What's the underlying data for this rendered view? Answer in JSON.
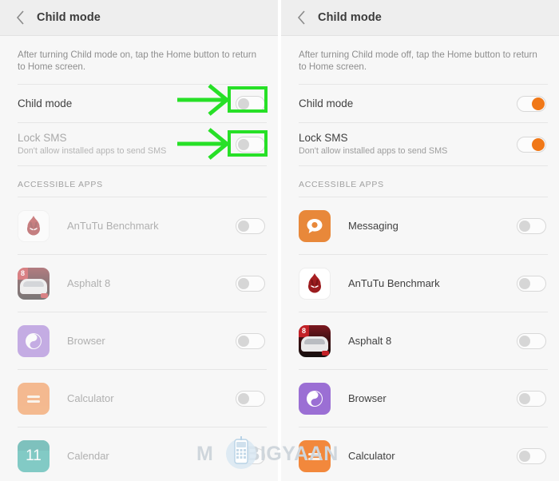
{
  "meta": {
    "watermark_text_left": "M",
    "watermark_text_right": "BIGYAAN",
    "accent_green": "#27e027",
    "accent_orange": "#f07818"
  },
  "panels": [
    {
      "id": "left",
      "appbar": {
        "title": "Child mode",
        "back_icon": "chevron-left-icon"
      },
      "description": "After turning Child mode on, tap the Home button to return to Home screen.",
      "settings": [
        {
          "title": "Child mode",
          "subtitle": "",
          "enabled": true,
          "toggle_on": false,
          "annotated": true
        },
        {
          "title": "Lock SMS",
          "subtitle": "Don't allow installed apps to send SMS",
          "enabled": false,
          "toggle_on": false,
          "annotated": true
        }
      ],
      "section_label": "ACCESSIBLE APPS",
      "apps": [
        {
          "name": "AnTuTu Benchmark",
          "icon": "antutu-icon",
          "toggle_on": false,
          "enabled": false
        },
        {
          "name": "Asphalt 8",
          "icon": "asphalt8-icon",
          "toggle_on": false,
          "enabled": false
        },
        {
          "name": "Browser",
          "icon": "browser-icon",
          "toggle_on": false,
          "enabled": false
        },
        {
          "name": "Calculator",
          "icon": "calculator-icon",
          "toggle_on": false,
          "enabled": false
        },
        {
          "name": "Calendar",
          "icon": "calendar-icon",
          "badge": "11",
          "toggle_on": false,
          "enabled": false
        }
      ]
    },
    {
      "id": "right",
      "appbar": {
        "title": "Child mode",
        "back_icon": "chevron-left-icon"
      },
      "description": "After turning Child mode off, tap the Home button to return to Home screen.",
      "settings": [
        {
          "title": "Child mode",
          "subtitle": "",
          "enabled": true,
          "toggle_on": true,
          "annotated": false
        },
        {
          "title": "Lock SMS",
          "subtitle": "Don't allow installed apps to send SMS",
          "enabled": true,
          "toggle_on": true,
          "annotated": false
        }
      ],
      "section_label": "ACCESSIBLE APPS",
      "apps": [
        {
          "name": "Messaging",
          "icon": "messaging-icon",
          "toggle_on": false,
          "enabled": true
        },
        {
          "name": "AnTuTu Benchmark",
          "icon": "antutu-icon",
          "toggle_on": false,
          "enabled": true
        },
        {
          "name": "Asphalt 8",
          "icon": "asphalt8-icon",
          "toggle_on": false,
          "enabled": true
        },
        {
          "name": "Browser",
          "icon": "browser-icon",
          "toggle_on": false,
          "enabled": true
        },
        {
          "name": "Calculator",
          "icon": "calculator-icon",
          "toggle_on": false,
          "enabled": true
        }
      ]
    }
  ]
}
